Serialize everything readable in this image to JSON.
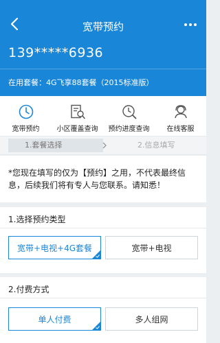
{
  "header": {
    "title": "宽带预约",
    "phone": "139*****6936",
    "plan": "在用套餐：4G飞享88套餐（2015标准版）"
  },
  "toolbar": {
    "items": [
      {
        "label": "宽带预约",
        "icon": "clock-icon"
      },
      {
        "label": "小区覆盖查询",
        "icon": "document-search-icon"
      },
      {
        "label": "预约进度查询",
        "icon": "clock-search-icon"
      },
      {
        "label": "在线客服",
        "icon": "customer-service-icon"
      }
    ]
  },
  "steps": {
    "step1": "1.套餐选择",
    "step2": "2.信息填写"
  },
  "notice": "*您现在填写的仅为【预约】之用，不代表最终信息，后续我们将有专人与您联系。请知悉！",
  "section1": {
    "title": "1.选择预约类型",
    "options": [
      "宽带+电视+4G套餐",
      "宽带+电视"
    ],
    "selected_index": 0
  },
  "section2": {
    "title": "2.付费方式",
    "options": [
      "单人付费",
      "多人组网"
    ],
    "selected_index": 0
  },
  "colors": {
    "accent": "#1a86d8",
    "background": "#eceff2"
  }
}
